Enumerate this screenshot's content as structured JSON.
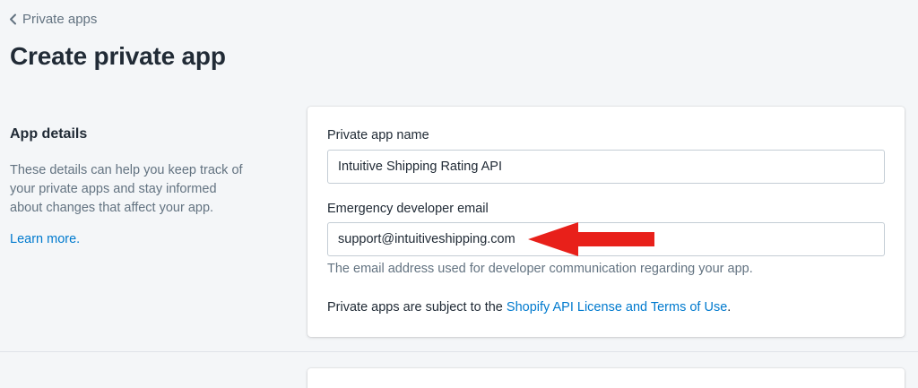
{
  "breadcrumb": {
    "label": "Private apps",
    "icon": "chevron-left-icon"
  },
  "page": {
    "title": "Create private app"
  },
  "section": {
    "title": "App details",
    "description": "These details can help you keep track of your private apps and stay informed about changes that affect your app.",
    "learn_more": "Learn more."
  },
  "form": {
    "app_name_label": "Private app name",
    "app_name_value": "Intuitive Shipping Rating API",
    "email_label": "Emergency developer email",
    "email_value": "support@intuitiveshipping.com",
    "email_help": "The email address used for developer communication regarding your app.",
    "terms_prefix": "Private apps are subject to the ",
    "terms_link": "Shopify API License and Terms of Use",
    "terms_suffix": "."
  },
  "annotation": {
    "icon": "red-arrow-icon",
    "color": "#e8201a"
  },
  "colors": {
    "link": "#007ace",
    "background": "#f4f6f8",
    "text": "#212b36",
    "subdued": "#637381"
  }
}
